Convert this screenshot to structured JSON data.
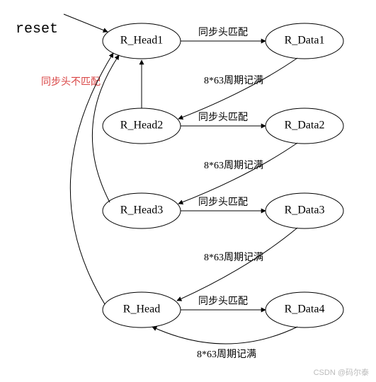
{
  "reset_label": "reset",
  "nodes": {
    "h1": "R_Head1",
    "d1": "R_Data1",
    "h2": "R_Head2",
    "d2": "R_Data2",
    "h3": "R_Head3",
    "d3": "R_Data3",
    "h4": "R_Head",
    "d4": "R_Data4"
  },
  "edges": {
    "match": "同步头匹配",
    "nomatch": "同步头不匹配",
    "full": "8*63周期记满"
  },
  "watermark": "CSDN @码尔泰"
}
